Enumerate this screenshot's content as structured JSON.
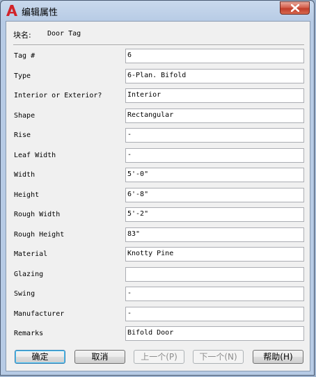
{
  "window": {
    "title": "编辑属性"
  },
  "block": {
    "label": "块名:",
    "name": "Door Tag"
  },
  "attributes": [
    {
      "label": "Tag #",
      "value": "6"
    },
    {
      "label": "Type",
      "value": "6-Plan. Bifold"
    },
    {
      "label": "Interior or Exterior?",
      "value": "Interior"
    },
    {
      "label": "Shape",
      "value": "Rectangular"
    },
    {
      "label": "Rise",
      "value": "-"
    },
    {
      "label": "Leaf Width",
      "value": "-"
    },
    {
      "label": "Width",
      "value": "5'-0\""
    },
    {
      "label": "Height",
      "value": "6'-8\""
    },
    {
      "label": "Rough Width",
      "value": "5'-2\""
    },
    {
      "label": "Rough Height",
      "value": "83\""
    },
    {
      "label": "Material",
      "value": "Knotty Pine"
    },
    {
      "label": "Glazing",
      "value": ""
    },
    {
      "label": "Swing",
      "value": "-"
    },
    {
      "label": "Manufacturer",
      "value": "-"
    },
    {
      "label": "Remarks",
      "value": "Bifold Door"
    }
  ],
  "buttons": {
    "ok": "确定",
    "cancel": "取消",
    "previous": "上一个(P)",
    "next": "下一个(N)",
    "help": "帮助(H)"
  },
  "icons": {
    "app": "autocad-logo-icon",
    "close": "close-icon"
  },
  "colors": {
    "app_icon_red": "#d2232a",
    "close_button": "#c13d2a"
  }
}
